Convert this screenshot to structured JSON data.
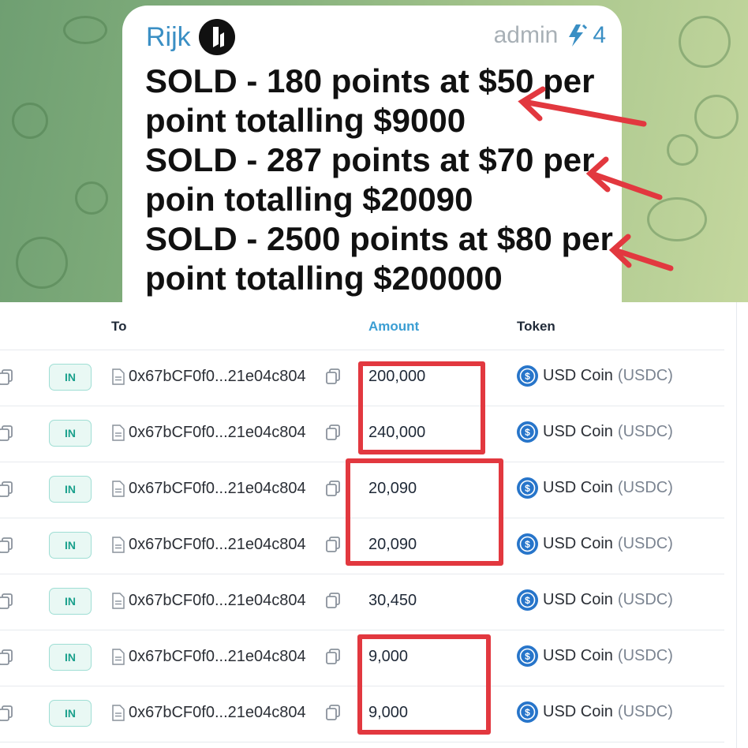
{
  "chat": {
    "sender_name": "Rijk",
    "badge_icon": "channel-logo-icon",
    "admin_label": "admin",
    "boost_icon": "lightning-boost-icon",
    "boost_count": "4",
    "message_lines": [
      "SOLD - 180 points at $50 per",
      "point totalling $9000",
      "SOLD - 287 points at $70 per",
      "poin totalling $20090",
      "SOLD - 2500 points at $80 per",
      "point totalling $200000"
    ]
  },
  "table": {
    "headers": {
      "to": "To",
      "amount": "Amount",
      "token": "Token"
    },
    "rows": [
      {
        "direction": "IN",
        "to": "0x67bCF0f0...21e04c804",
        "amount": "200,000",
        "token_name": "USD Coin",
        "token_symbol": "(USDC)"
      },
      {
        "direction": "IN",
        "to": "0x67bCF0f0...21e04c804",
        "amount": "240,000",
        "token_name": "USD Coin",
        "token_symbol": "(USDC)"
      },
      {
        "direction": "IN",
        "to": "0x67bCF0f0...21e04c804",
        "amount": "20,090",
        "token_name": "USD Coin",
        "token_symbol": "(USDC)"
      },
      {
        "direction": "IN",
        "to": "0x67bCF0f0...21e04c804",
        "amount": "20,090",
        "token_name": "USD Coin",
        "token_symbol": "(USDC)"
      },
      {
        "direction": "IN",
        "to": "0x67bCF0f0...21e04c804",
        "amount": "30,450",
        "token_name": "USD Coin",
        "token_symbol": "(USDC)"
      },
      {
        "direction": "IN",
        "to": "0x67bCF0f0...21e04c804",
        "amount": "9,000",
        "token_name": "USD Coin",
        "token_symbol": "(USDC)"
      },
      {
        "direction": "IN",
        "to": "0x67bCF0f0...21e04c804",
        "amount": "9,000",
        "token_name": "USD Coin",
        "token_symbol": "(USDC)"
      }
    ]
  },
  "colors": {
    "link_blue": "#3a8fc4",
    "amount_header": "#3b9ed3",
    "in_badge": "#1aa08c",
    "usdc": "#2775ca",
    "annotation_red": "#e2383f"
  }
}
